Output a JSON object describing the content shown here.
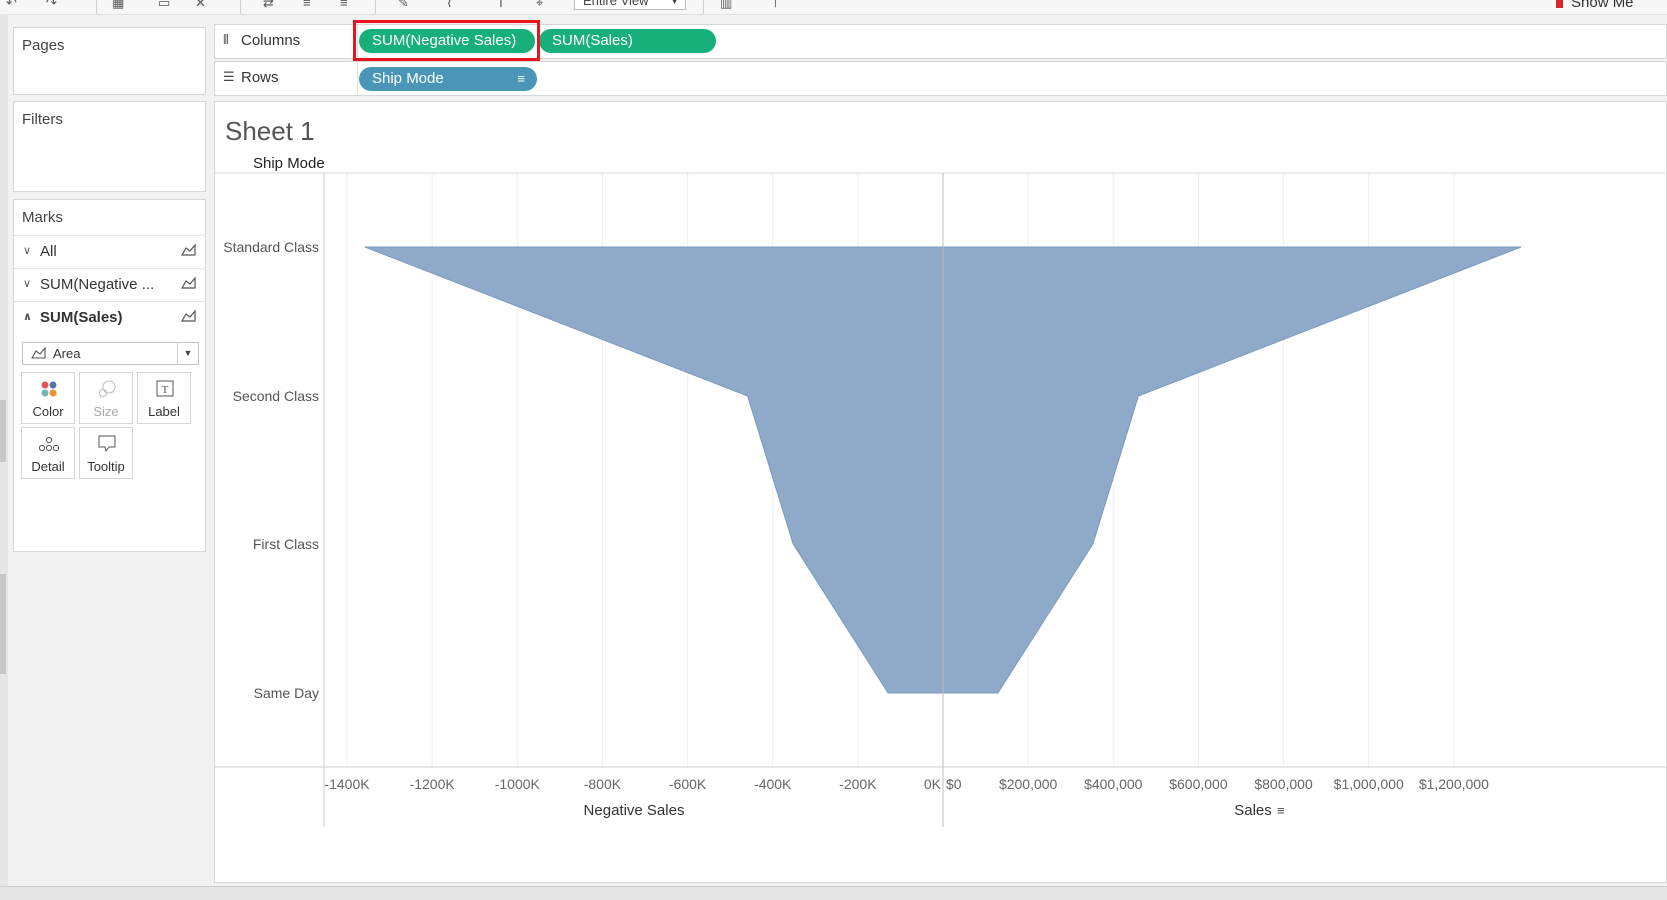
{
  "toolbar": {
    "view_select": "Entire View",
    "show_me": "Show Me",
    "icons": [
      "undo-icon",
      "redo-icon",
      "new-sheet-icon",
      "duplicate-icon",
      "clear-icon",
      "swap-icon",
      "sort-ascending-icon",
      "sort-descending-icon",
      "highlight-icon",
      "group-icon",
      "label-icon",
      "pin-icon",
      "fit-icon",
      "presentation-icon"
    ]
  },
  "panes": {
    "pages_title": "Pages",
    "filters_title": "Filters",
    "marks_title": "Marks"
  },
  "marks": {
    "rows": [
      {
        "label": "All",
        "bold": false,
        "expanded": false
      },
      {
        "label": "SUM(Negative ...",
        "bold": false,
        "expanded": false
      },
      {
        "label": "SUM(Sales)",
        "bold": true,
        "expanded": true
      }
    ],
    "mark_type": "Area",
    "cards": [
      {
        "label": "Color",
        "enabled": true
      },
      {
        "label": "Size",
        "enabled": false
      },
      {
        "label": "Label",
        "enabled": true
      },
      {
        "label": "Detail",
        "enabled": true
      },
      {
        "label": "Tooltip",
        "enabled": true
      }
    ]
  },
  "shelves": {
    "columns_label": "Columns",
    "rows_label": "Rows",
    "column_pills": [
      "SUM(Negative Sales)",
      "SUM(Sales)"
    ],
    "row_pills": [
      "Ship Mode"
    ]
  },
  "sheet": {
    "title": "Sheet 1",
    "row_header": "Ship Mode"
  },
  "colors": {
    "area_fill": "#8faac8",
    "area_stroke": "#7c9bbd",
    "pill_green": "#17b07a",
    "pill_blue": "#4b96b8",
    "highlight": "#e8151b"
  },
  "chart_data": {
    "type": "area",
    "orientation": "horizontal",
    "categories": [
      "Standard Class",
      "Second Class",
      "First Class",
      "Same Day"
    ],
    "series": [
      {
        "name": "Negative Sales",
        "values": [
          -1358000,
          -459000,
          -352000,
          -129000
        ]
      },
      {
        "name": "Sales",
        "values": [
          1358000,
          459000,
          352000,
          129000
        ]
      }
    ],
    "left_axis": {
      "label": "Negative Sales",
      "range": [
        -1420000,
        0
      ],
      "ticks": [
        -1400000,
        -1200000,
        -1000000,
        -800000,
        -600000,
        -400000,
        -200000,
        0
      ],
      "tick_labels": [
        "-1400K",
        "-1200K",
        "-1000K",
        "-800K",
        "-600K",
        "-400K",
        "-200K",
        "0K"
      ]
    },
    "right_axis": {
      "label": "Sales",
      "range": [
        0,
        1420000
      ],
      "ticks": [
        0,
        200000,
        400000,
        600000,
        800000,
        1000000,
        1200000
      ],
      "tick_labels": [
        "$0",
        "$200,000",
        "$400,000",
        "$600,000",
        "$800,000",
        "$1,000,000",
        "$1,200,000"
      ]
    },
    "grid": true
  }
}
